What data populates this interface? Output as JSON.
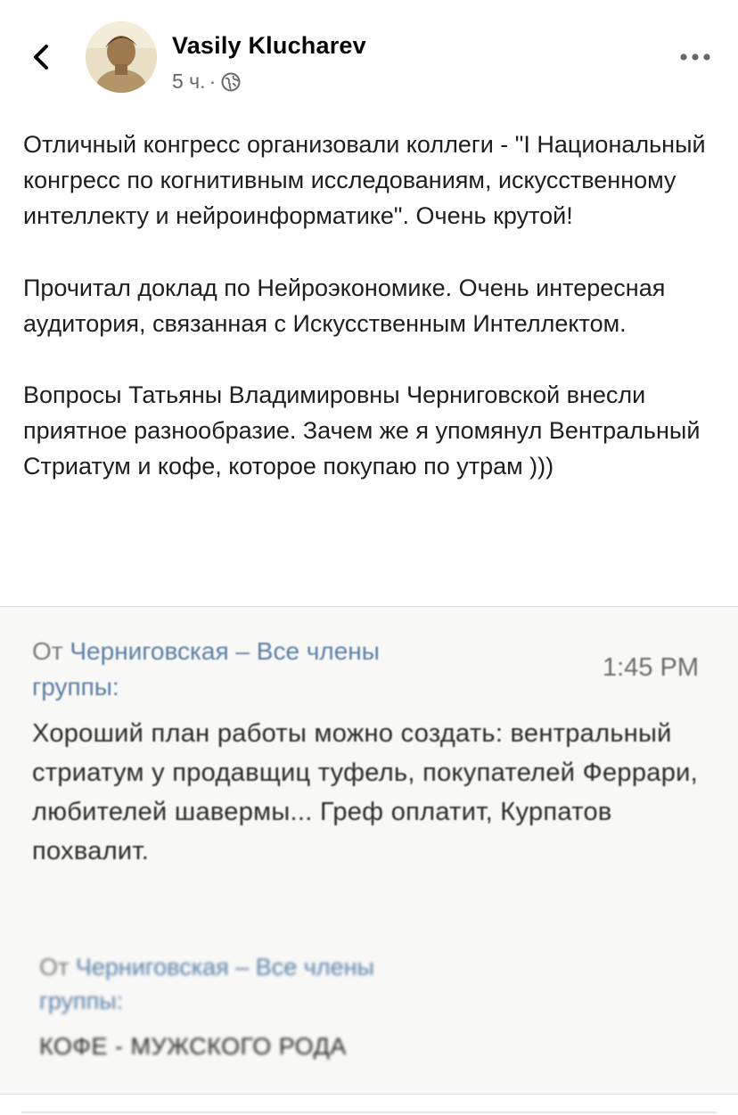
{
  "header": {
    "author_name": "Vasily Klucharev",
    "time": "5 ч.",
    "separator": "·",
    "privacy_icon": "globe-icon",
    "back_icon": "chevron-left-icon",
    "more_icon": "more-horizontal-icon"
  },
  "post": {
    "paragraphs": [
      "Отличный конгресс  организовали коллеги - \"I Национальный конгресс по когнитивным исследованиям, искусственному интеллекту и нейроинформатике\". Очень крутой!",
      "Прочитал доклад по Нейроэкономике. Очень интересная аудитория, связанная с Искусственным Интеллектом.",
      "Вопросы Татьяны Владимировны Черниговской внесли приятное разнообразие. Зачем же я упомянул Вентральный Стриатум и кофе, которое покупаю по утрам )))"
    ]
  },
  "photo": {
    "message1": {
      "from_prefix": "От ",
      "from_group_line1": "Черниговская – Все члены",
      "from_group_line2": "группы:",
      "time": "1:45 PM",
      "body": "Хороший план работы можно создать: вентральный стриатум у продавщиц туфель, покупателей Феррари, любителей шавермы... Греф оплатит, Курпатов похвалит."
    },
    "message2": {
      "from_prefix": "От ",
      "from_group_line1": "Черниговская – Все члены",
      "from_group_line2": "группы:",
      "body": "КОФЕ - МУЖСКОГО РОДА"
    }
  },
  "colors": {
    "name": "#050505",
    "meta": "#65676b",
    "text": "#1c1e21",
    "group_link": "#5b80a8"
  }
}
